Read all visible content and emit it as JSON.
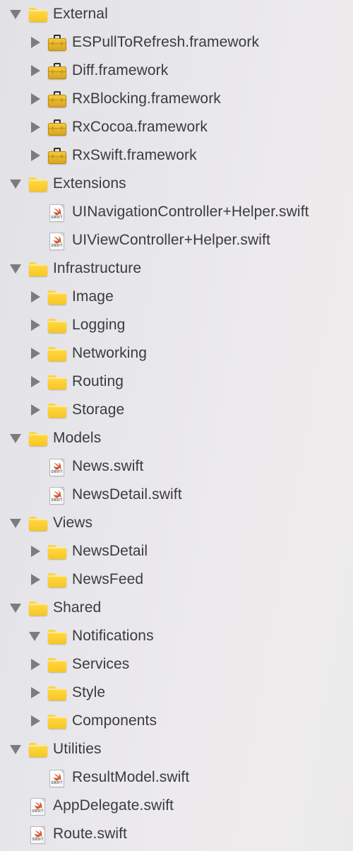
{
  "panel": {
    "name": "Xcode Project Navigator",
    "background_color": "#ebeaec",
    "text_color": "#3b3b3d",
    "triangle_color": "#7b7b80",
    "folder_color": "#fdd035",
    "framework_color": "#e8b72c",
    "swift_icon_color": "#d4542b",
    "swift_icon_tag": "SWIFT"
  },
  "tree": [
    {
      "label": "External",
      "depth": 0,
      "kind": "folder",
      "disclosure": "expanded"
    },
    {
      "label": "ESPullToRefresh.framework",
      "depth": 1,
      "kind": "framework",
      "disclosure": "collapsed"
    },
    {
      "label": "Diff.framework",
      "depth": 1,
      "kind": "framework",
      "disclosure": "collapsed"
    },
    {
      "label": "RxBlocking.framework",
      "depth": 1,
      "kind": "framework",
      "disclosure": "collapsed"
    },
    {
      "label": "RxCocoa.framework",
      "depth": 1,
      "kind": "framework",
      "disclosure": "collapsed"
    },
    {
      "label": "RxSwift.framework",
      "depth": 1,
      "kind": "framework",
      "disclosure": "collapsed"
    },
    {
      "label": "Extensions",
      "depth": 0,
      "kind": "folder",
      "disclosure": "expanded"
    },
    {
      "label": "UINavigationController+Helper.swift",
      "depth": 1,
      "kind": "swift",
      "disclosure": "none"
    },
    {
      "label": "UIViewController+Helper.swift",
      "depth": 1,
      "kind": "swift",
      "disclosure": "none"
    },
    {
      "label": "Infrastructure",
      "depth": 0,
      "kind": "folder",
      "disclosure": "expanded"
    },
    {
      "label": "Image",
      "depth": 1,
      "kind": "folder",
      "disclosure": "collapsed"
    },
    {
      "label": "Logging",
      "depth": 1,
      "kind": "folder",
      "disclosure": "collapsed"
    },
    {
      "label": "Networking",
      "depth": 1,
      "kind": "folder",
      "disclosure": "collapsed"
    },
    {
      "label": "Routing",
      "depth": 1,
      "kind": "folder",
      "disclosure": "collapsed"
    },
    {
      "label": "Storage",
      "depth": 1,
      "kind": "folder",
      "disclosure": "collapsed"
    },
    {
      "label": "Models",
      "depth": 0,
      "kind": "folder",
      "disclosure": "expanded"
    },
    {
      "label": "News.swift",
      "depth": 1,
      "kind": "swift",
      "disclosure": "none"
    },
    {
      "label": "NewsDetail.swift",
      "depth": 1,
      "kind": "swift",
      "disclosure": "none"
    },
    {
      "label": "Views",
      "depth": 0,
      "kind": "folder",
      "disclosure": "expanded"
    },
    {
      "label": "NewsDetail",
      "depth": 1,
      "kind": "folder",
      "disclosure": "collapsed"
    },
    {
      "label": "NewsFeed",
      "depth": 1,
      "kind": "folder",
      "disclosure": "collapsed"
    },
    {
      "label": "Shared",
      "depth": 0,
      "kind": "folder",
      "disclosure": "expanded"
    },
    {
      "label": "Notifications",
      "depth": 1,
      "kind": "folder",
      "disclosure": "expanded"
    },
    {
      "label": "Services",
      "depth": 1,
      "kind": "folder",
      "disclosure": "collapsed"
    },
    {
      "label": "Style",
      "depth": 1,
      "kind": "folder",
      "disclosure": "collapsed"
    },
    {
      "label": "Components",
      "depth": 1,
      "kind": "folder",
      "disclosure": "collapsed"
    },
    {
      "label": "Utilities",
      "depth": 0,
      "kind": "folder",
      "disclosure": "expanded"
    },
    {
      "label": "ResultModel.swift",
      "depth": 1,
      "kind": "swift",
      "disclosure": "none"
    },
    {
      "label": "AppDelegate.swift",
      "depth": 0,
      "kind": "swift",
      "disclosure": "none"
    },
    {
      "label": "Route.swift",
      "depth": 0,
      "kind": "swift",
      "disclosure": "none"
    }
  ]
}
